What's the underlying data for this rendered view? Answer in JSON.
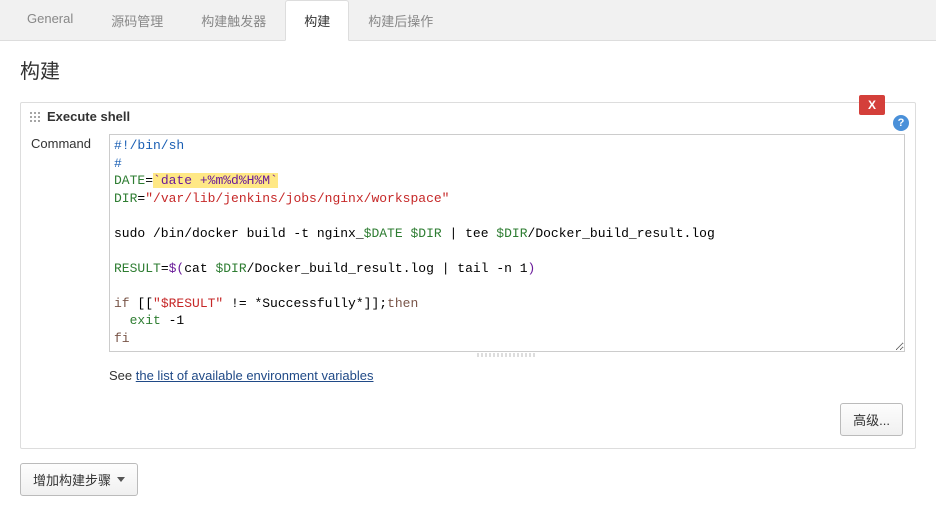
{
  "tabs": {
    "general": "General",
    "scm": "源码管理",
    "triggers": "构建触发器",
    "build": "构建",
    "post": "构建后操作"
  },
  "section": {
    "title": "构建"
  },
  "step": {
    "header": "Execute shell",
    "close": "X",
    "help": "?",
    "command_label": "Command"
  },
  "code": {
    "l1a": "#!/bin/sh",
    "l2a": "#",
    "l3a": "DATE",
    "l3b": "=",
    "l3c": "`date +%m%d%H%M`",
    "l4a": "DIR",
    "l4b": "=",
    "l4c": "\"/var/lib/jenkins/jobs/nginx/workspace\"",
    "l6a": "sudo /bin/docker build -t nginx_",
    "l6b": "$DATE",
    "l6c": " ",
    "l6d": "$DIR",
    "l6e": " | tee ",
    "l6f": "$DIR",
    "l6g": "/Docker_build_result.log",
    "l8a": "RESULT",
    "l8b": "=",
    "l8c": "$(",
    "l8d": "cat ",
    "l8e": "$DIR",
    "l8f": "/Docker_build_result.log | tail -n 1",
    "l8g": ")",
    "l10a": "if",
    "l10b": " [[",
    "l10c": "\"$RESULT\"",
    "l10d": " != *Successfully*]];",
    "l10e": "then",
    "l11a": "  exit",
    "l11b": " -1",
    "l12a": "fi"
  },
  "env": {
    "prefix": "See ",
    "link": "the list of available environment variables"
  },
  "buttons": {
    "advanced": "高级...",
    "add_step": "增加构建步骤"
  }
}
